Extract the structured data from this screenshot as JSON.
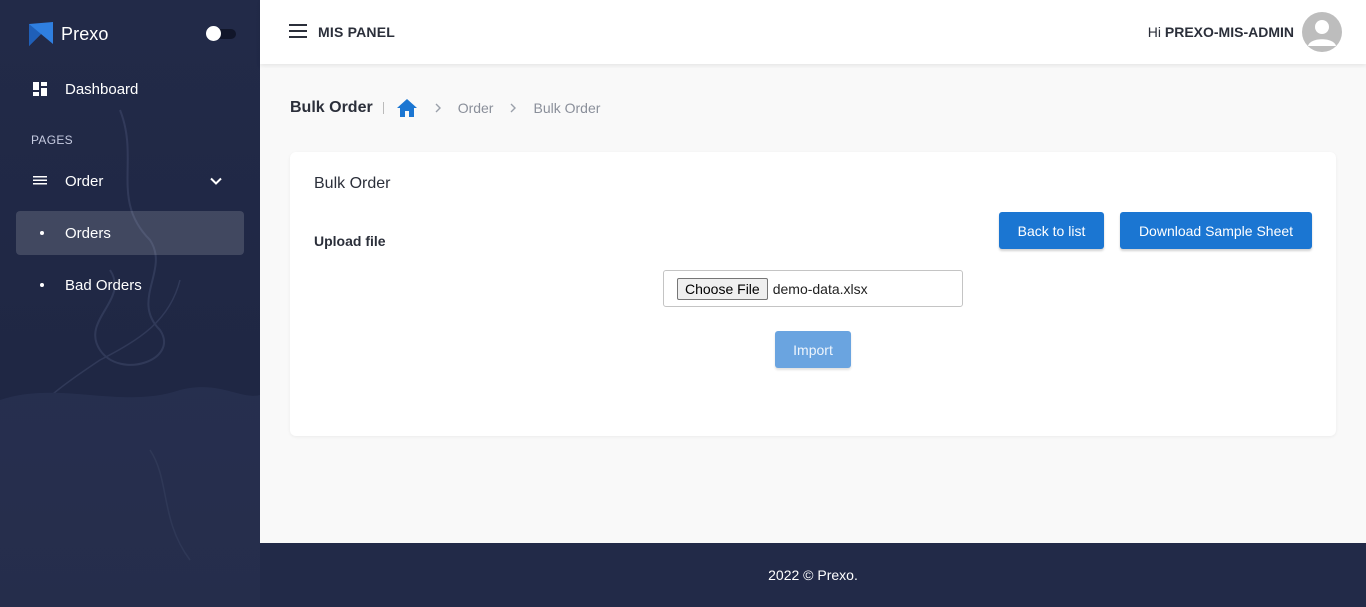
{
  "brand": {
    "name": "Prexo",
    "logo_icon": "prexo-logo-icon",
    "accent": "#2f7fe0"
  },
  "sidebar": {
    "dashboard_label": "Dashboard",
    "section_label": "PAGES",
    "order_label": "Order",
    "subitems": [
      {
        "label": "Orders",
        "active": true
      },
      {
        "label": "Bad Orders",
        "active": false
      }
    ]
  },
  "topbar": {
    "title": "MIS PANEL",
    "greeting_prefix": "Hi",
    "username": "PREXO-MIS-ADMIN"
  },
  "breadcrumb": {
    "page_title": "Bulk Order",
    "items": [
      "Order",
      "Bulk Order"
    ]
  },
  "card": {
    "title": "Bulk Order",
    "upload_label": "Upload file",
    "back_button": "Back to list",
    "download_button": "Download Sample Sheet",
    "choose_file_button": "Choose File",
    "file_name": "demo-data.xlsx",
    "import_button": "Import"
  },
  "footer": {
    "text": "2022 © Prexo."
  },
  "colors": {
    "sidebar_bg": "#222a48",
    "primary": "#1b76d2",
    "primary_disabled": "#6aa4e0"
  }
}
